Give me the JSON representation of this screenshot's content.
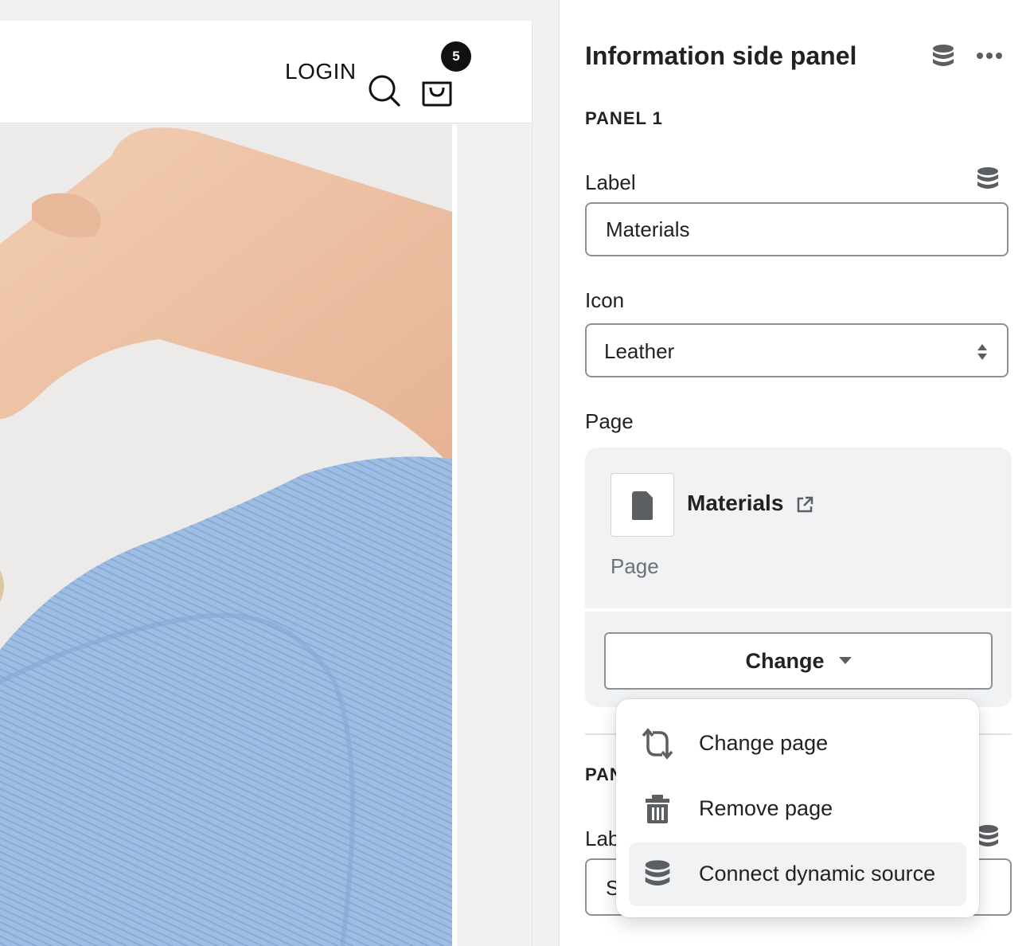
{
  "storefront": {
    "header": {
      "login_label": "LOGIN",
      "cart_count": "5"
    }
  },
  "panel": {
    "title": "Information side panel",
    "sections": [
      {
        "heading": "PANEL 1",
        "label_field": {
          "label": "Label",
          "value": "Materials"
        },
        "icon_field": {
          "label": "Icon",
          "value": "Leather"
        },
        "page_field": {
          "label": "Page",
          "page_name": "Materials",
          "page_type": "Page",
          "change_button_label": "Change"
        }
      },
      {
        "heading": "PAN",
        "label_field": {
          "label": "Lab",
          "value": "S"
        }
      }
    ]
  },
  "menu": {
    "items": [
      {
        "label": "Change page",
        "icon": "swap-arrows-icon"
      },
      {
        "label": "Remove page",
        "icon": "trash-icon"
      },
      {
        "label": "Connect dynamic source",
        "icon": "database-icon"
      }
    ],
    "active_index": 2
  },
  "colors": {
    "text_primary": "#202223",
    "text_subdued": "#6d7175",
    "surface_subdued": "#f1f2f4",
    "border": "#8c9196",
    "icon": "#5c5f62",
    "badge": "#111111"
  }
}
